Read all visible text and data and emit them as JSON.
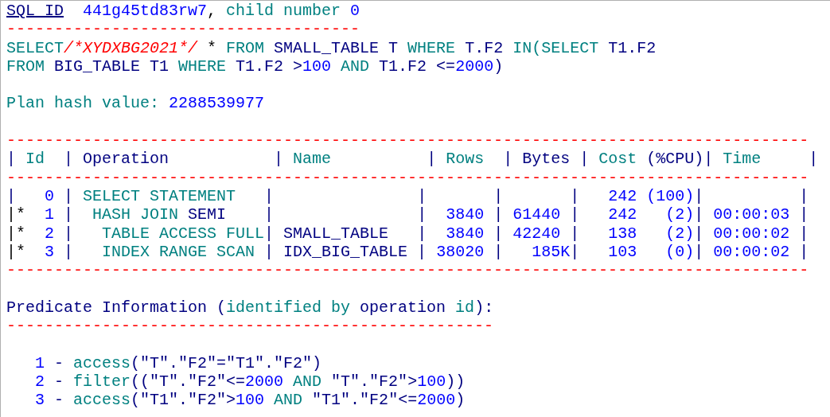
{
  "lines": [
    {
      "kind": "code",
      "segments": [
        {
          "text": "SQL_ID",
          "kind": "link"
        },
        {
          "text": "  441g45td83rw7",
          "kind": "num"
        },
        {
          "text": ", ",
          "kind": "plain"
        },
        {
          "text": "child number ",
          "kind": "kw"
        },
        {
          "text": "0",
          "kind": "num"
        }
      ]
    },
    {
      "kind": "rule",
      "text": "-------------------------------------"
    },
    {
      "kind": "code",
      "segments": [
        {
          "text": "SELECT",
          "kind": "kw"
        },
        {
          "text": "/*XYDXBG2021*/",
          "kind": "cmt"
        },
        {
          "text": " * ",
          "kind": "plain"
        },
        {
          "text": "FROM ",
          "kind": "kw"
        },
        {
          "text": "SMALL_TABLE T ",
          "kind": "id"
        },
        {
          "text": "WHERE ",
          "kind": "kw"
        },
        {
          "text": "T.F2 ",
          "kind": "id"
        },
        {
          "text": "IN(SELECT ",
          "kind": "kw"
        },
        {
          "text": "T1.F2",
          "kind": "id"
        }
      ]
    },
    {
      "kind": "code",
      "segments": [
        {
          "text": "FROM ",
          "kind": "kw"
        },
        {
          "text": "BIG_TABLE T1 ",
          "kind": "id"
        },
        {
          "text": "WHERE ",
          "kind": "kw"
        },
        {
          "text": "T1.F2 >",
          "kind": "id"
        },
        {
          "text": "100",
          "kind": "num"
        },
        {
          "text": " AND ",
          "kind": "kw"
        },
        {
          "text": "T1.F2 <=",
          "kind": "id"
        },
        {
          "text": "2000",
          "kind": "num"
        },
        {
          "text": ")",
          "kind": "id"
        }
      ]
    },
    {
      "kind": "blank"
    },
    {
      "kind": "code",
      "segments": [
        {
          "text": "Plan hash value: ",
          "kind": "kw"
        },
        {
          "text": "2288539977",
          "kind": "num"
        }
      ]
    },
    {
      "kind": "blank"
    },
    {
      "kind": "rule",
      "text": "------------------------------------------------------------------------------------"
    },
    {
      "kind": "code",
      "segments": [
        {
          "text": "| ",
          "kind": "id"
        },
        {
          "text": "Id",
          "kind": "kw"
        },
        {
          "text": "  | Operation           | ",
          "kind": "id"
        },
        {
          "text": "Name",
          "kind": "kw"
        },
        {
          "text": "          | ",
          "kind": "id"
        },
        {
          "text": "Rows",
          "kind": "kw"
        },
        {
          "text": "  | Bytes | ",
          "kind": "id"
        },
        {
          "text": "Cost",
          "kind": "kw"
        },
        {
          "text": " (%CPU)| ",
          "kind": "id"
        },
        {
          "text": "Time",
          "kind": "kw"
        },
        {
          "text": "     |",
          "kind": "id"
        }
      ]
    },
    {
      "kind": "rule",
      "text": "------------------------------------------------------------------------------------"
    },
    {
      "kind": "code",
      "segments": [
        {
          "text": "|   ",
          "kind": "id"
        },
        {
          "text": "0",
          "kind": "num"
        },
        {
          "text": " | ",
          "kind": "id"
        },
        {
          "text": "SELECT STATEMENT   ",
          "kind": "kw"
        },
        {
          "text": "|               |       |       |   ",
          "kind": "id"
        },
        {
          "text": "242 (100)",
          "kind": "num"
        },
        {
          "text": "|          |",
          "kind": "id"
        }
      ]
    },
    {
      "kind": "code",
      "segments": [
        {
          "text": "|*  ",
          "kind": "plain"
        },
        {
          "text": "1",
          "kind": "num"
        },
        {
          "text": " |  ",
          "kind": "id"
        },
        {
          "text": "HASH JOIN ",
          "kind": "kw"
        },
        {
          "text": "SEMI    |               |  ",
          "kind": "id"
        },
        {
          "text": "3840",
          "kind": "num"
        },
        {
          "text": " | ",
          "kind": "id"
        },
        {
          "text": "61440",
          "kind": "num"
        },
        {
          "text": " |   ",
          "kind": "id"
        },
        {
          "text": "242   (2)",
          "kind": "num"
        },
        {
          "text": "| ",
          "kind": "id"
        },
        {
          "text": "00:00:03",
          "kind": "num"
        },
        {
          "text": " |",
          "kind": "id"
        }
      ]
    },
    {
      "kind": "code",
      "segments": [
        {
          "text": "|*  ",
          "kind": "plain"
        },
        {
          "text": "2",
          "kind": "num"
        },
        {
          "text": " |   ",
          "kind": "id"
        },
        {
          "text": "TABLE ACCESS FULL",
          "kind": "kw"
        },
        {
          "text": "| SMALL_TABLE   |  ",
          "kind": "id"
        },
        {
          "text": "3840",
          "kind": "num"
        },
        {
          "text": " | ",
          "kind": "id"
        },
        {
          "text": "42240",
          "kind": "num"
        },
        {
          "text": " |   ",
          "kind": "id"
        },
        {
          "text": "138   (2)",
          "kind": "num"
        },
        {
          "text": "| ",
          "kind": "id"
        },
        {
          "text": "00:00:02",
          "kind": "num"
        },
        {
          "text": " |",
          "kind": "id"
        }
      ]
    },
    {
      "kind": "code",
      "segments": [
        {
          "text": "|*  ",
          "kind": "plain"
        },
        {
          "text": "3",
          "kind": "num"
        },
        {
          "text": " |   ",
          "kind": "id"
        },
        {
          "text": "INDEX RANGE SCAN",
          "kind": "kw"
        },
        {
          "text": " | IDX_BIG_TABLE | ",
          "kind": "id"
        },
        {
          "text": "38020",
          "kind": "num"
        },
        {
          "text": " |   ",
          "kind": "id"
        },
        {
          "text": "185K",
          "kind": "num"
        },
        {
          "text": "|   ",
          "kind": "id"
        },
        {
          "text": "103   (0)",
          "kind": "num"
        },
        {
          "text": "| ",
          "kind": "id"
        },
        {
          "text": "00:00:02",
          "kind": "num"
        },
        {
          "text": " |",
          "kind": "id"
        }
      ]
    },
    {
      "kind": "rule",
      "text": "------------------------------------------------------------------------------------"
    },
    {
      "kind": "blank"
    },
    {
      "kind": "code",
      "segments": [
        {
          "text": "Predicate Information (",
          "kind": "id"
        },
        {
          "text": "identified by ",
          "kind": "kw"
        },
        {
          "text": "operation ",
          "kind": "id"
        },
        {
          "text": "id",
          "kind": "kw"
        },
        {
          "text": "):",
          "kind": "id"
        }
      ]
    },
    {
      "kind": "rule",
      "text": "---------------------------------------------------"
    },
    {
      "kind": "blank"
    },
    {
      "kind": "code",
      "segments": [
        {
          "text": "   1",
          "kind": "num"
        },
        {
          "text": " - ",
          "kind": "id"
        },
        {
          "text": "access",
          "kind": "kw"
        },
        {
          "text": "(\"T\".\"F2\"=\"T1\".\"F2\")",
          "kind": "id"
        }
      ]
    },
    {
      "kind": "code",
      "segments": [
        {
          "text": "   2",
          "kind": "num"
        },
        {
          "text": " - ",
          "kind": "id"
        },
        {
          "text": "filter",
          "kind": "kw"
        },
        {
          "text": "((\"T\".\"F2\"<=",
          "kind": "id"
        },
        {
          "text": "2000",
          "kind": "num"
        },
        {
          "text": " AND ",
          "kind": "kw"
        },
        {
          "text": "\"T\".\"F2\">",
          "kind": "id"
        },
        {
          "text": "100",
          "kind": "num"
        },
        {
          "text": "))",
          "kind": "id"
        }
      ]
    },
    {
      "kind": "code",
      "segments": [
        {
          "text": "   3",
          "kind": "num"
        },
        {
          "text": " - ",
          "kind": "id"
        },
        {
          "text": "access",
          "kind": "kw"
        },
        {
          "text": "(\"T1\".\"F2\">",
          "kind": "id"
        },
        {
          "text": "100",
          "kind": "num"
        },
        {
          "text": " AND ",
          "kind": "kw"
        },
        {
          "text": "\"T1\".\"F2\"<=",
          "kind": "id"
        },
        {
          "text": "2000",
          "kind": "num"
        },
        {
          "text": ")",
          "kind": "id"
        }
      ]
    }
  ]
}
